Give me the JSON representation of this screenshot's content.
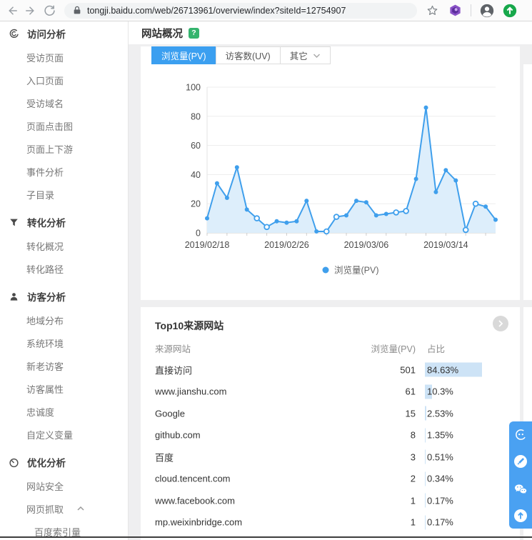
{
  "browser": {
    "url": "tongji.baidu.com/web/26713961/overview/index?siteId=12754907"
  },
  "page": {
    "title": "网站概况",
    "help_badge": "?"
  },
  "sidebar": {
    "sections": [
      {
        "id": "visit-analysis",
        "label": "访问分析",
        "icon": "visit-analysis-icon",
        "items": [
          {
            "label": "受访页面"
          },
          {
            "label": "入口页面"
          },
          {
            "label": "受访域名"
          },
          {
            "label": "页面点击图"
          },
          {
            "label": "页面上下游"
          },
          {
            "label": "事件分析"
          },
          {
            "label": "子目录"
          }
        ]
      },
      {
        "id": "conversion-analysis",
        "label": "转化分析",
        "icon": "funnel-icon",
        "items": [
          {
            "label": "转化概况"
          },
          {
            "label": "转化路径"
          }
        ]
      },
      {
        "id": "visitor-analysis",
        "label": "访客分析",
        "icon": "visitor-icon",
        "items": [
          {
            "label": "地域分布"
          },
          {
            "label": "系统环境"
          },
          {
            "label": "新老访客"
          },
          {
            "label": "访客属性"
          },
          {
            "label": "忠诚度"
          },
          {
            "label": "自定义变量"
          }
        ]
      },
      {
        "id": "optimization-analysis",
        "label": "优化分析",
        "icon": "gauge-icon",
        "items": [
          {
            "label": "网站安全"
          },
          {
            "label": "网页抓取",
            "caret": "up"
          },
          {
            "label": "百度索引量",
            "indent": true
          }
        ]
      }
    ]
  },
  "tabs": {
    "items": [
      {
        "label": "浏览量(PV)",
        "active": true
      },
      {
        "label": "访客数(UV)",
        "active": false
      },
      {
        "label": "其它",
        "active": false,
        "has_caret": true
      }
    ]
  },
  "chart_data": {
    "type": "line",
    "title": "",
    "xlabel": "",
    "ylabel": "",
    "ylim": [
      0,
      100
    ],
    "y_ticks": [
      0,
      20,
      40,
      60,
      80,
      100
    ],
    "grid": true,
    "legend_position": "bottom",
    "x_labels": [
      "2019/02/18",
      "2019/02/26",
      "2019/03/06",
      "2019/03/14"
    ],
    "x_label_indices": [
      0,
      8,
      16,
      24
    ],
    "series": [
      {
        "name": "浏览量(PV)",
        "color": "#3f9fec",
        "area_fill": "#ddeefb",
        "values": [
          10,
          34,
          24,
          45,
          16,
          10,
          4,
          8,
          7,
          8,
          22,
          1,
          1,
          11,
          12,
          22,
          21,
          12,
          13,
          14,
          15,
          37,
          86,
          28,
          43,
          36,
          2,
          20,
          18,
          9
        ],
        "hollow_point_indices": [
          5,
          6,
          12,
          13,
          19,
          20,
          26,
          27
        ]
      }
    ]
  },
  "top_sources": {
    "title": "Top10来源网站",
    "columns": [
      "来源网站",
      "浏览量(PV)",
      "占比"
    ],
    "rows": [
      {
        "source": "直接访问",
        "pv": "501",
        "ratio": "84.63%",
        "ratio_value": 84.63
      },
      {
        "source": "www.jianshu.com",
        "pv": "61",
        "ratio": "10.3%",
        "ratio_value": 10.3
      },
      {
        "source": "Google",
        "pv": "15",
        "ratio": "2.53%",
        "ratio_value": 2.53
      },
      {
        "source": "github.com",
        "pv": "8",
        "ratio": "1.35%",
        "ratio_value": 1.35
      },
      {
        "source": "百度",
        "pv": "3",
        "ratio": "0.51%",
        "ratio_value": 0.51
      },
      {
        "source": "cloud.tencent.com",
        "pv": "2",
        "ratio": "0.34%",
        "ratio_value": 0.34
      },
      {
        "source": "www.facebook.com",
        "pv": "1",
        "ratio": "0.17%",
        "ratio_value": 0.17
      },
      {
        "source": "mp.weixinbridge.com",
        "pv": "1",
        "ratio": "0.17%",
        "ratio_value": 0.17
      }
    ]
  },
  "colors": {
    "accent": "#3b9ff0",
    "line": "#3f9fec",
    "area_fill": "#ddeefb",
    "ratio_bar": "#cde3f6",
    "panel_blue": "#4aa1f2",
    "help_green": "#35b46e"
  }
}
